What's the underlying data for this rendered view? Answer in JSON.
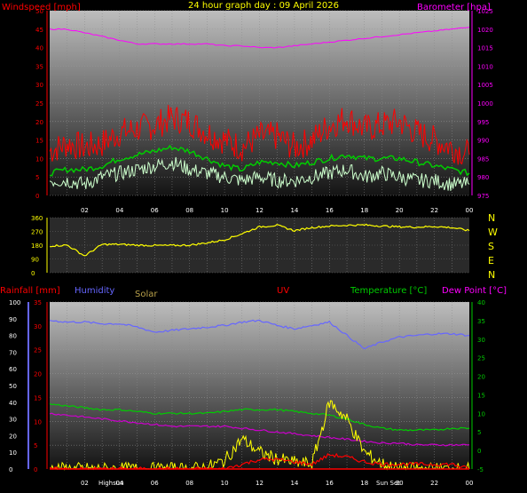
{
  "header": {
    "title": "24 hour graph day : 09 April 2026",
    "windspeed_label": "Windspeed [mph]",
    "barometer_label": "Barometer [hpa]"
  },
  "lower_header": {
    "rainfall": "Rainfall [mm]",
    "humidity": "Humidity",
    "solar": "Solar",
    "uv": "UV",
    "temperature": "Temperature [°C]",
    "dewpoint": "Dew Point [°C]"
  },
  "markers": {
    "highsun": "Highsun",
    "sunset": "Sun Set"
  },
  "compass": [
    "N",
    "W",
    "S",
    "E",
    "N"
  ],
  "colors": {
    "windspeed_axis": "#ff0000",
    "barometer_axis": "#ff00ff",
    "title": "#ffff00",
    "gust": "#ff0000",
    "avg_wind": "#00cc00",
    "wind": "#ccffcc",
    "direction": "#ffff00",
    "humidity": "#6666ff",
    "solar": "#ffff00",
    "uv": "#ff0000",
    "temperature": "#00cc00",
    "dewpoint": "#cc00cc",
    "rain": "#ff0000"
  },
  "chart_data": [
    {
      "type": "line",
      "title": "24 hour graph day : 09 April 2026",
      "x_ticks": [
        "02",
        "04",
        "06",
        "08",
        "10",
        "12",
        "14",
        "16",
        "18",
        "20",
        "22",
        "00"
      ],
      "x_hours": [
        0,
        1,
        2,
        3,
        4,
        5,
        6,
        7,
        8,
        9,
        10,
        11,
        12,
        13,
        14,
        15,
        16,
        17,
        18,
        19,
        20,
        21,
        22,
        23,
        24
      ],
      "ylabel_left": "Windspeed [mph]",
      "ylim_left": [
        0,
        50
      ],
      "yticks_left": [
        0,
        5,
        10,
        15,
        20,
        25,
        30,
        35,
        40,
        45,
        50
      ],
      "ylabel_right": "Barometer [hpa]",
      "ylim_right": [
        975,
        1025
      ],
      "yticks_right": [
        975,
        980,
        985,
        990,
        995,
        1000,
        1005,
        1010,
        1015,
        1020,
        1025
      ],
      "series": [
        {
          "key": "gust",
          "color": "#ff0000",
          "axis": "left",
          "values": [
            12,
            14,
            13,
            14,
            17,
            18,
            19,
            21,
            20,
            17,
            15,
            13,
            16,
            16,
            13,
            15,
            19,
            21,
            18,
            19,
            20,
            17,
            15,
            13,
            11
          ]
        },
        {
          "key": "average",
          "color": "#00cc00",
          "axis": "left",
          "values": [
            6,
            7,
            7,
            8,
            10,
            11,
            12,
            13,
            12,
            10,
            8,
            7,
            9,
            9,
            8,
            9,
            10,
            11,
            10,
            10,
            10,
            9,
            8,
            7,
            6
          ]
        },
        {
          "key": "wind",
          "color": "#ccffcc",
          "axis": "left",
          "values": [
            4,
            4,
            3,
            5,
            6,
            7,
            8,
            9,
            7,
            6,
            5,
            4,
            5,
            4,
            4,
            5,
            6,
            7,
            5,
            6,
            5,
            4,
            4,
            3,
            3
          ]
        },
        {
          "key": "barometer",
          "color": "#ff00ff",
          "axis": "right",
          "values": [
            1020,
            1020,
            1019,
            1018,
            1017,
            1016,
            1016,
            1016,
            1016,
            1016,
            1015.5,
            1015.5,
            1015,
            1015,
            1015.5,
            1016,
            1016.5,
            1017,
            1017.5,
            1018,
            1018.5,
            1019,
            1019.5,
            1020,
            1020.5
          ]
        }
      ]
    },
    {
      "type": "line",
      "x_hours": [
        0,
        1,
        2,
        3,
        4,
        5,
        6,
        7,
        8,
        9,
        10,
        11,
        12,
        13,
        14,
        15,
        16,
        17,
        18,
        19,
        20,
        21,
        22,
        23,
        24
      ],
      "ylim": [
        0,
        360
      ],
      "yticks": [
        0,
        90,
        180,
        270,
        360
      ],
      "series": [
        {
          "key": "direction",
          "color": "#ffff00",
          "values": [
            175,
            180,
            110,
            185,
            185,
            180,
            178,
            178,
            180,
            195,
            215,
            255,
            300,
            310,
            275,
            295,
            305,
            310,
            312,
            305,
            300,
            298,
            302,
            295,
            275
          ]
        }
      ]
    },
    {
      "type": "line",
      "title": "",
      "x_ticks": [
        "02",
        "04",
        "06",
        "08",
        "10",
        "12",
        "14",
        "16",
        "18",
        "20",
        "22",
        "00"
      ],
      "x_hours": [
        0,
        1,
        2,
        3,
        4,
        5,
        6,
        7,
        8,
        9,
        10,
        11,
        12,
        13,
        14,
        15,
        16,
        17,
        18,
        19,
        20,
        21,
        22,
        23,
        24
      ],
      "ylim_humidity": [
        0,
        100
      ],
      "yticks_humidity": [
        0,
        10,
        20,
        30,
        40,
        50,
        60,
        70,
        80,
        90,
        100
      ],
      "ylim_rain": [
        0,
        35
      ],
      "yticks_rain": [
        0,
        5,
        10,
        15,
        20,
        25,
        30,
        35
      ],
      "ylim_temperature": [
        -5,
        40
      ],
      "yticks_temperature": [
        -5,
        0,
        5,
        10,
        15,
        20,
        25,
        30,
        35,
        40
      ],
      "series": [
        {
          "key": "humidity",
          "color": "#6666ff",
          "axis": "humidity",
          "values": [
            89,
            88,
            88,
            87,
            87,
            85,
            82,
            83,
            84,
            85,
            86,
            88,
            89,
            86,
            84,
            86,
            88,
            80,
            72,
            76,
            79,
            80,
            81,
            81,
            80
          ]
        },
        {
          "key": "temperature",
          "color": "#00cc00",
          "axis": "temperature",
          "values": [
            12.5,
            12,
            11.5,
            11,
            11,
            10.5,
            10,
            10,
            10,
            10,
            10.5,
            11,
            11,
            11,
            10.5,
            10,
            9.5,
            8.5,
            7,
            6,
            5.5,
            5.5,
            5.5,
            6,
            6
          ]
        },
        {
          "key": "dewpoint",
          "color": "#cc00cc",
          "axis": "temperature",
          "values": [
            10,
            9.5,
            9,
            8.5,
            8,
            7.5,
            7,
            6.5,
            6.5,
            6.5,
            6.5,
            6,
            5.5,
            5,
            4.5,
            4,
            3.5,
            3,
            2.5,
            2,
            2,
            1.5,
            1.5,
            1.5,
            1.5
          ]
        },
        {
          "key": "solar",
          "color": "#ffff00",
          "axis": "humidity",
          "values": [
            0,
            0,
            0,
            0,
            0,
            0,
            0,
            0,
            0,
            1,
            5,
            18,
            10,
            6,
            4,
            3,
            40,
            30,
            10,
            3,
            0,
            0,
            0,
            0,
            0
          ]
        },
        {
          "key": "uv",
          "color": "#ff0000",
          "axis": "rain",
          "values": [
            0,
            0,
            0,
            0,
            0,
            0,
            0,
            0,
            0,
            0,
            0,
            1,
            2,
            2,
            1.5,
            1,
            3,
            2.5,
            1.5,
            1,
            1,
            1,
            1,
            1,
            0
          ]
        },
        {
          "key": "rainfall",
          "color": "#ff0000",
          "axis": "rain",
          "values": [
            0,
            0,
            0,
            0,
            0,
            0,
            0,
            0,
            0,
            0,
            0,
            0,
            0,
            0,
            0,
            0,
            0,
            0,
            0,
            0,
            0,
            0,
            0,
            0,
            0
          ]
        }
      ]
    }
  ]
}
